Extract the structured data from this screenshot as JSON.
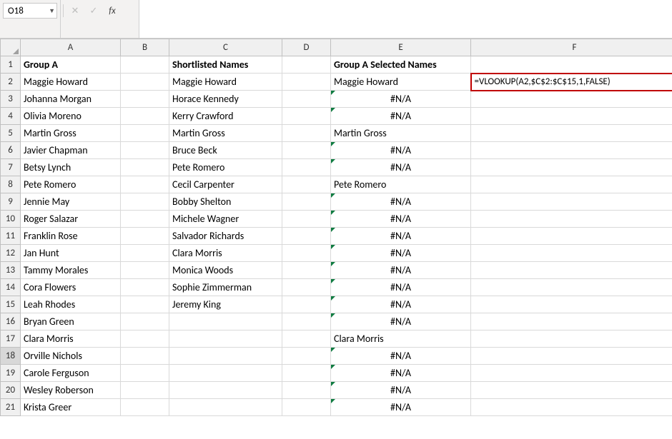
{
  "nameBox": "O18",
  "formulaBar": "",
  "columns": [
    "A",
    "B",
    "C",
    "D",
    "E",
    "F"
  ],
  "headers": {
    "A": "Group A",
    "C": "Shortlisted Names",
    "E": "Group A Selected Names"
  },
  "formulaCell": "=VLOOKUP(A2,$C$2:$C$15,1,FALSE)",
  "naText": "#N/A",
  "rows": [
    {
      "n": 1,
      "A": "__HDR_A__",
      "C": "__HDR_C__",
      "E": "__HDR_E__",
      "bold": true
    },
    {
      "n": 2,
      "A": "Maggie Howard",
      "C": "Maggie Howard",
      "E": "Maggie Howard",
      "F": "__FORMULA__"
    },
    {
      "n": 3,
      "A": "Johanna Morgan",
      "C": "Horace Kennedy",
      "E": "__NA__"
    },
    {
      "n": 4,
      "A": "Olivia Moreno",
      "C": "Kerry Crawford",
      "E": "__NA__"
    },
    {
      "n": 5,
      "A": "Martin Gross",
      "C": "Martin Gross",
      "E": "Martin Gross"
    },
    {
      "n": 6,
      "A": "Javier Chapman",
      "C": "Bruce Beck",
      "E": "__NA__"
    },
    {
      "n": 7,
      "A": "Betsy Lynch",
      "C": "Pete Romero",
      "E": "__NA__"
    },
    {
      "n": 8,
      "A": "Pete Romero",
      "C": "Cecil Carpenter",
      "E": "Pete Romero"
    },
    {
      "n": 9,
      "A": "Jennie May",
      "C": "Bobby Shelton",
      "E": "__NA__"
    },
    {
      "n": 10,
      "A": "Roger Salazar",
      "C": "Michele Wagner",
      "E": "__NA__"
    },
    {
      "n": 11,
      "A": "Franklin Rose",
      "C": "Salvador Richards",
      "E": "__NA__"
    },
    {
      "n": 12,
      "A": "Jan Hunt",
      "C": "Clara Morris",
      "E": "__NA__"
    },
    {
      "n": 13,
      "A": "Tammy Morales",
      "C": "Monica Woods",
      "E": "__NA__"
    },
    {
      "n": 14,
      "A": "Cora Flowers",
      "C": "Sophie Zimmerman",
      "E": "__NA__"
    },
    {
      "n": 15,
      "A": "Leah Rhodes",
      "C": "Jeremy King",
      "E": "__NA__"
    },
    {
      "n": 16,
      "A": "Bryan Green",
      "E": "__NA__"
    },
    {
      "n": 17,
      "A": "Clara Morris",
      "E": "Clara Morris"
    },
    {
      "n": 18,
      "A": "Orville Nichols",
      "E": "__NA__",
      "rowSel": true
    },
    {
      "n": 19,
      "A": "Carole Ferguson",
      "E": "__NA__"
    },
    {
      "n": 20,
      "A": "Wesley Roberson",
      "E": "__NA__"
    },
    {
      "n": 21,
      "A": "Krista Greer",
      "E": "__NA__"
    }
  ]
}
